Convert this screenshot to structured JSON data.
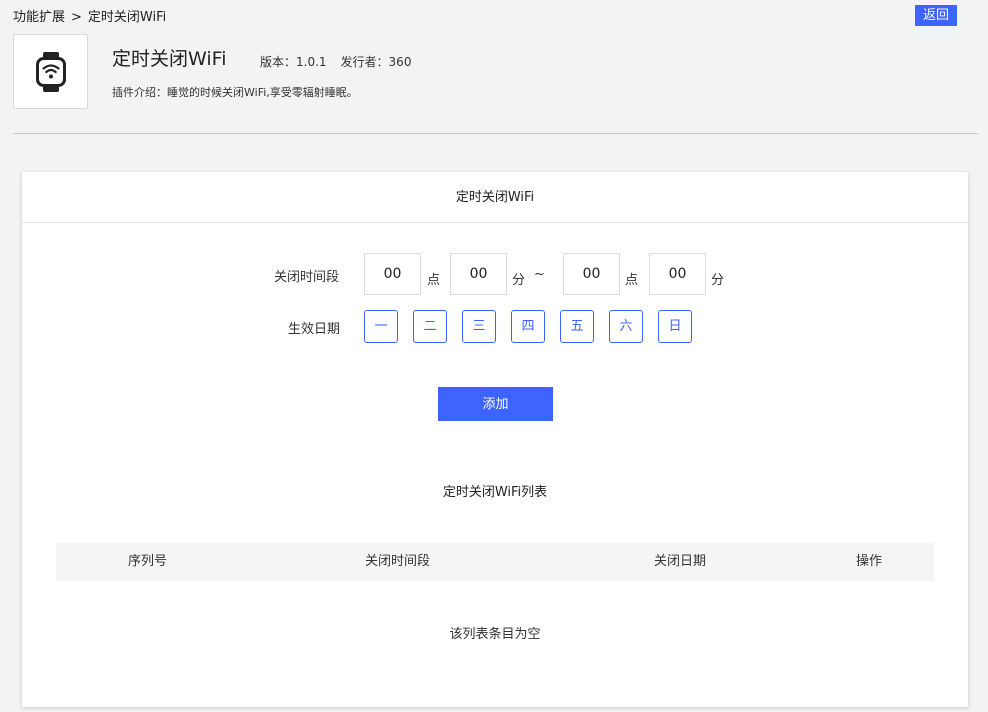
{
  "breadcrumb": {
    "parent": "功能扩展",
    "separator": ">",
    "current": "定时关闭WiFi"
  },
  "header": {
    "back_label": "返回",
    "plugin_icon": "smartwatch-wifi-icon",
    "title": "定时关闭WiFi",
    "version": "版本：1.0.1",
    "publisher": "发行者：360",
    "description": "插件介绍：睡觉的时候关闭WiFi,享受零辐射睡眠。"
  },
  "panel": {
    "title": "定时关闭WiFi",
    "period_label": "关闭时间段",
    "start_hour": "00",
    "start_minute": "00",
    "end_hour": "00",
    "end_minute": "00",
    "hour_unit": "点",
    "minute_unit": "分",
    "range_sep": "~",
    "days_label": "生效日期",
    "days": [
      "一",
      "二",
      "三",
      "四",
      "五",
      "六",
      "日"
    ],
    "add_label": "添加"
  },
  "list": {
    "title": "定时关闭WiFi列表",
    "columns": [
      "序列号",
      "关闭时间段",
      "关闭日期",
      "操作"
    ],
    "empty_text": "该列表条目为空"
  },
  "colors": {
    "accent": "#3d64ff",
    "background": "#f2f3f5"
  }
}
